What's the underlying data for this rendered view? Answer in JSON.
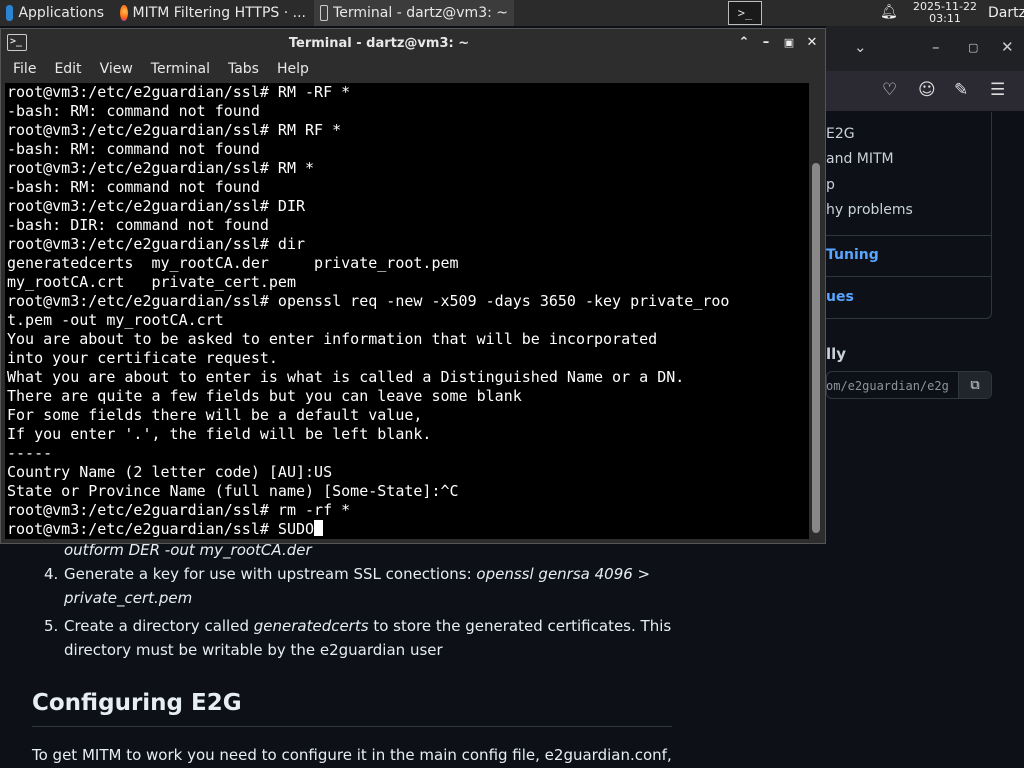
{
  "panel": {
    "applications_label": "Applications",
    "firefox_task_label": "MITM Filtering HTTPS · ...",
    "terminal_task_label": "Terminal - dartz@vm3: ~",
    "clock_date": "2025-11-22",
    "clock_time": "03:11",
    "user_label": "Dartz"
  },
  "terminal": {
    "title": "Terminal - dartz@vm3: ~",
    "menu": [
      "File",
      "Edit",
      "View",
      "Terminal",
      "Tabs",
      "Help"
    ],
    "lines": [
      "root@vm3:/etc/e2guardian/ssl# RM -RF *",
      "-bash: RM: command not found",
      "root@vm3:/etc/e2guardian/ssl# RM RF *",
      "-bash: RM: command not found",
      "root@vm3:/etc/e2guardian/ssl# RM *",
      "-bash: RM: command not found",
      "root@vm3:/etc/e2guardian/ssl# DIR",
      "-bash: DIR: command not found",
      "root@vm3:/etc/e2guardian/ssl# dir",
      "generatedcerts  my_rootCA.der     private_root.pem",
      "my_rootCA.crt   private_cert.pem",
      "root@vm3:/etc/e2guardian/ssl# openssl req -new -x509 -days 3650 -key private_roo",
      "t.pem -out my_rootCA.crt",
      "You are about to be asked to enter information that will be incorporated",
      "into your certificate request.",
      "What you are about to enter is what is called a Distinguished Name or a DN.",
      "There are quite a few fields but you can leave some blank",
      "For some fields there will be a default value,",
      "If you enter '.', the field will be left blank.",
      "-----",
      "Country Name (2 letter code) [AU]:US",
      "State or Province Name (full name) [Some-State]:^C",
      "root@vm3:/etc/e2guardian/ssl# rm -rf *",
      "root@vm3:/etc/e2guardian/ssl# SUDO"
    ]
  },
  "browser": {
    "toc": [
      {
        "label": "E2G"
      },
      {
        "label": "and MITM"
      },
      {
        "label": "p"
      },
      {
        "label": "hy problems"
      },
      {
        "label": "Tuning"
      },
      {
        "label": "ues"
      }
    ],
    "clone_heading": "lly",
    "clone_url": "om/e2guardian/e2g",
    "article": {
      "item3_cont": "outform DER -out my_rootCA.der",
      "item4_num": "4.",
      "item4_text": "Generate a key for use with upstream SSL conections: ",
      "item4_code": "openssl genrsa 4096 > private_cert.pem",
      "item5_num": "5.",
      "item5_text1": "Create a directory called ",
      "item5_code": "generatedcerts",
      "item5_text2": " to store the generated certificates. This directory must be writable by the e2guardian user",
      "heading": "Configuring E2G",
      "paragraph": "To get MITM to work you need to configure it in the main config file, e2guardian.conf,"
    }
  }
}
